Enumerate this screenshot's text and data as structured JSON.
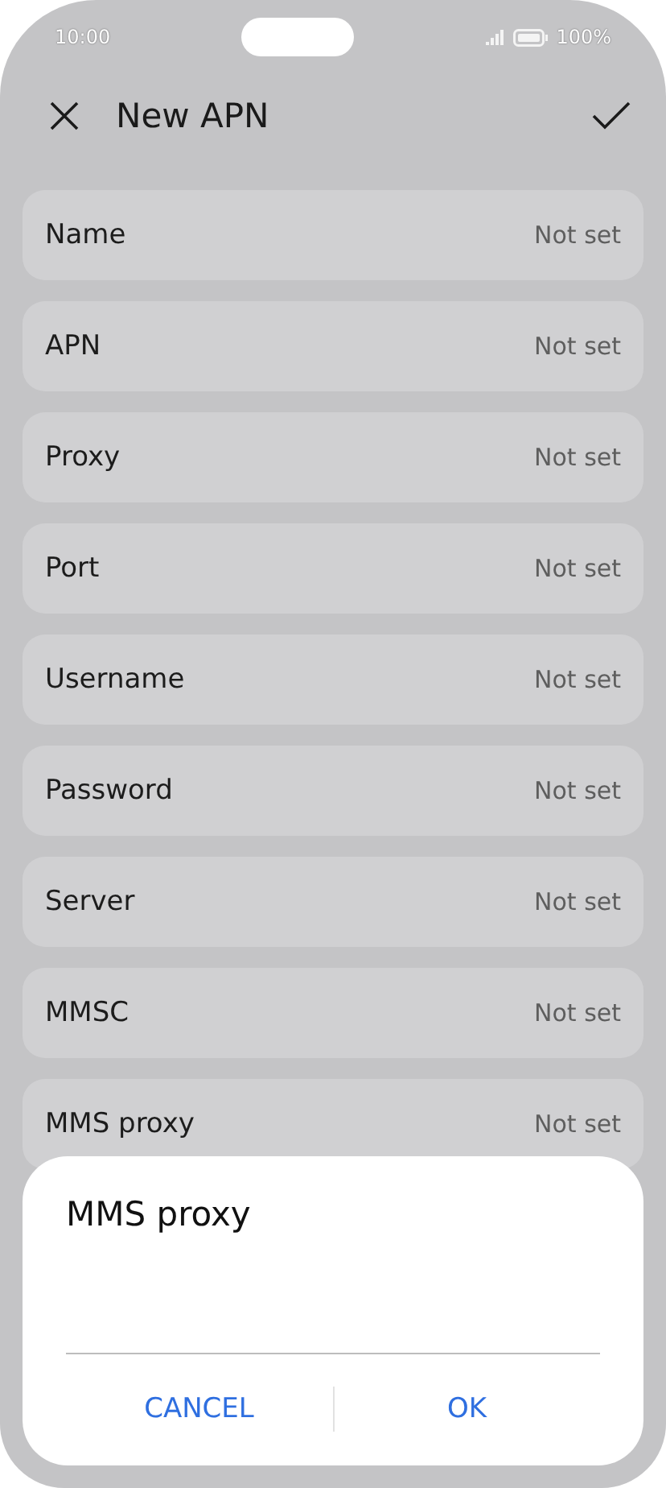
{
  "status_bar": {
    "time": "10:00",
    "battery": "100%"
  },
  "header": {
    "title": "New APN"
  },
  "fields": [
    {
      "label": "Name",
      "value": "Not set"
    },
    {
      "label": "APN",
      "value": "Not set"
    },
    {
      "label": "Proxy",
      "value": "Not set"
    },
    {
      "label": "Port",
      "value": "Not set"
    },
    {
      "label": "Username",
      "value": "Not set"
    },
    {
      "label": "Password",
      "value": "Not set"
    },
    {
      "label": "Server",
      "value": "Not set"
    },
    {
      "label": "MMSC",
      "value": "Not set"
    },
    {
      "label": "MMS proxy",
      "value": "Not set"
    }
  ],
  "dialog": {
    "title": "MMS proxy",
    "buttons": [
      "CANCEL",
      "OK"
    ]
  }
}
